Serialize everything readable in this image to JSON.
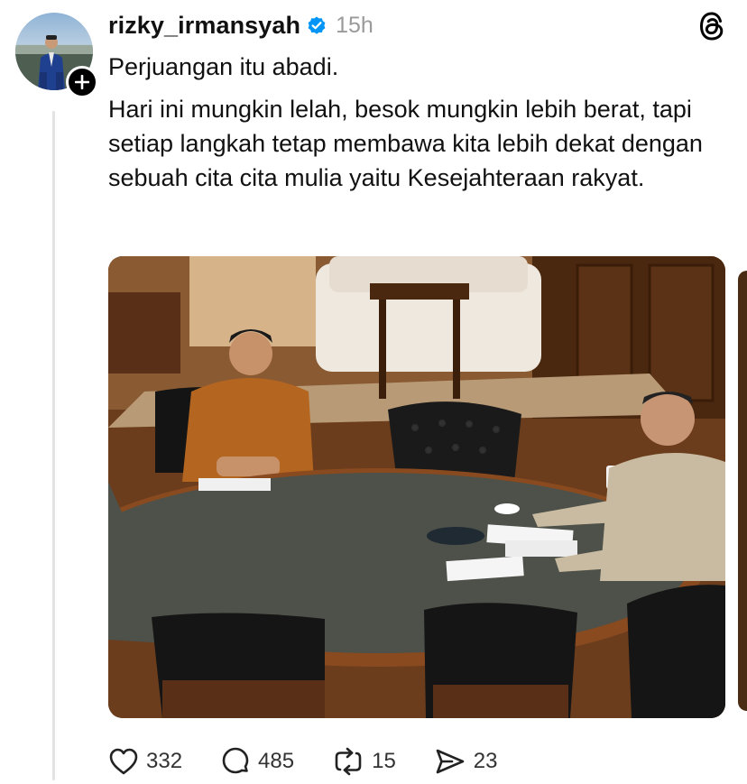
{
  "post": {
    "author": {
      "username": "rizky_irmansyah",
      "verified": true,
      "time_ago": "15h"
    },
    "text": {
      "line1": "Perjuangan itu abadi.",
      "paragraph2": "Hari ini mungkin lelah, besok mungkin lebih berat, tapi setiap langkah tetap membawa kita lebih dekat dengan sebuah cita cita mulia yaitu Kesejahteraan rakyat."
    },
    "stats": {
      "likes": "332",
      "replies": "485",
      "reposts": "15",
      "shares": "23"
    }
  },
  "icons": {
    "verified": "verified-check-icon",
    "follow": "plus-icon",
    "app": "threads-logo-icon",
    "like": "heart-icon",
    "reply": "comment-icon",
    "repost": "repost-icon",
    "share": "send-icon"
  },
  "colors": {
    "verified_blue": "#0095f6",
    "text": "#111111",
    "muted": "#9a9a9a",
    "thread_line": "#e3e3e3"
  }
}
